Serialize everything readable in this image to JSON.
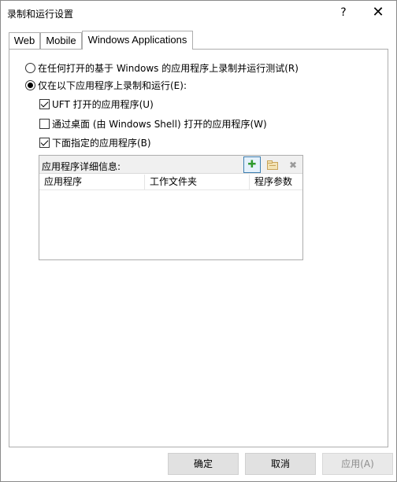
{
  "window": {
    "title": "录制和运行设置",
    "help_label": "?",
    "close_label": "✕"
  },
  "tabs": [
    {
      "label": "Web",
      "active": false
    },
    {
      "label": "Mobile",
      "active": false
    },
    {
      "label": "Windows Applications",
      "active": true
    }
  ],
  "options": {
    "radio_any": {
      "label": "在任何打开的基于 Windows 的应用程序上录制并运行测试(R)",
      "selected": false
    },
    "radio_only": {
      "label": "仅在以下应用程序上录制和运行(E):",
      "selected": true
    },
    "check_uft": {
      "label": "UFT 打开的应用程序(U)",
      "checked": true
    },
    "check_shell": {
      "label": "通过桌面 (由 Windows Shell) 打开的应用程序(W)",
      "checked": false
    },
    "check_specified": {
      "label": "下面指定的应用程序(B)",
      "checked": true
    }
  },
  "details": {
    "label": "应用程序详细信息:",
    "add_icon": "add-icon",
    "edit_icon": "edit-icon",
    "delete_icon": "delete-icon",
    "columns": [
      "应用程序",
      "工作文件夹",
      "程序参数"
    ],
    "rows": []
  },
  "buttons": {
    "ok": "确定",
    "cancel": "取消",
    "apply": "应用(A)"
  }
}
